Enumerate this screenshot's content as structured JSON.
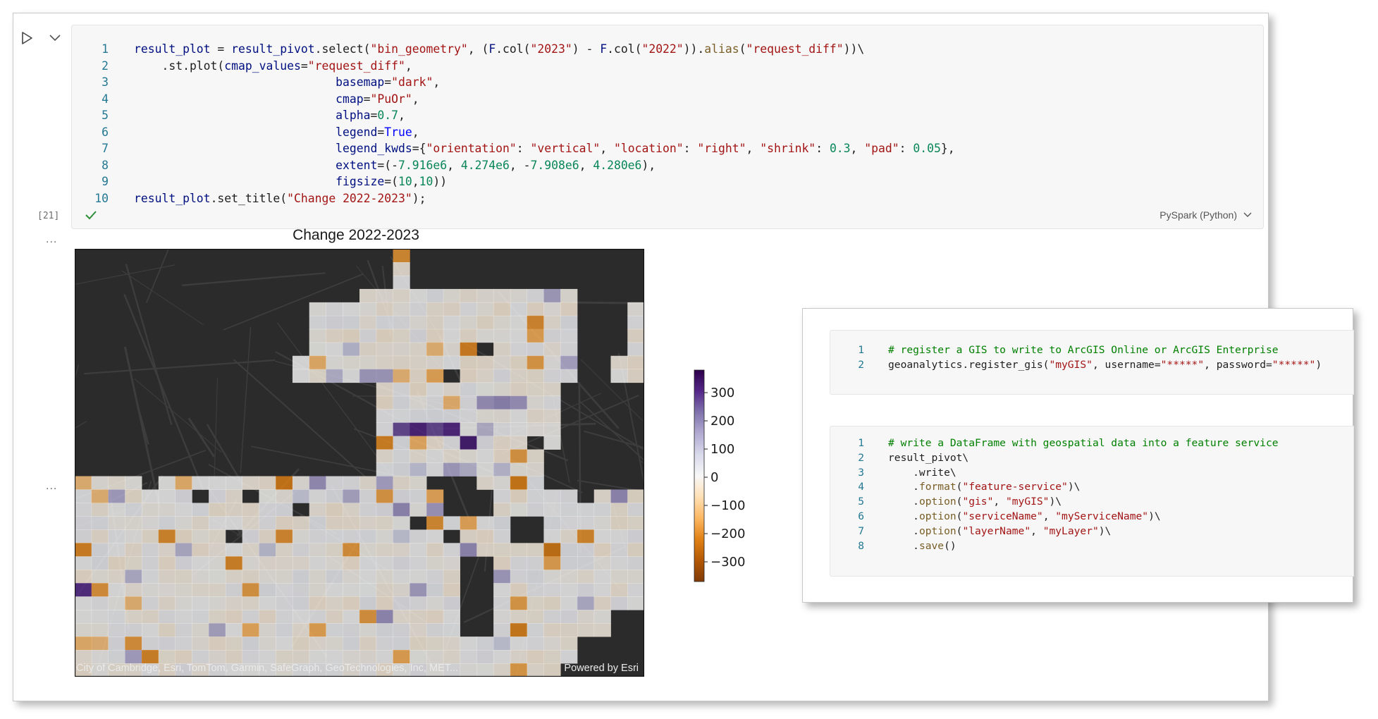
{
  "cell": {
    "execution_count": "[21]",
    "kernel": "PySpark (Python)",
    "lines": [
      {
        "n": "1",
        "t": [
          [
            "v",
            "result_plot"
          ],
          [
            "",
            " = "
          ],
          [
            "v",
            "result_pivot"
          ],
          [
            "",
            ".select("
          ],
          [
            "s",
            "\"bin_geometry\""
          ],
          [
            "",
            ", ("
          ],
          [
            "v",
            "F"
          ],
          [
            "",
            ".col("
          ],
          [
            "s",
            "\"2023\""
          ],
          [
            "",
            ") - "
          ],
          [
            "v",
            "F"
          ],
          [
            "",
            ".col("
          ],
          [
            "s",
            "\"2022\""
          ],
          [
            "",
            "))."
          ],
          [
            "f",
            "alias"
          ],
          [
            "",
            "("
          ],
          [
            "s",
            "\"request_diff\""
          ],
          [
            "",
            "))\\"
          ]
        ]
      },
      {
        "n": "2",
        "t": [
          [
            "",
            "    .st.plot("
          ],
          [
            "v",
            "cmap_values"
          ],
          [
            "",
            "="
          ],
          [
            "s",
            "\"request_diff\""
          ],
          [
            "",
            ","
          ]
        ]
      },
      {
        "n": "3",
        "t": [
          [
            "",
            "                             "
          ],
          [
            "v",
            "basemap"
          ],
          [
            "",
            "="
          ],
          [
            "s",
            "\"dark\""
          ],
          [
            "",
            ","
          ]
        ]
      },
      {
        "n": "4",
        "t": [
          [
            "",
            "                             "
          ],
          [
            "v",
            "cmap"
          ],
          [
            "",
            "="
          ],
          [
            "s",
            "\"PuOr\""
          ],
          [
            "",
            ","
          ]
        ]
      },
      {
        "n": "5",
        "t": [
          [
            "",
            "                             "
          ],
          [
            "v",
            "alpha"
          ],
          [
            "",
            "="
          ],
          [
            "n",
            "0.7"
          ],
          [
            "",
            ","
          ]
        ]
      },
      {
        "n": "6",
        "t": [
          [
            "",
            "                             "
          ],
          [
            "v",
            "legend"
          ],
          [
            "",
            "="
          ],
          [
            "k",
            "True"
          ],
          [
            "",
            ","
          ]
        ]
      },
      {
        "n": "7",
        "t": [
          [
            "",
            "                             "
          ],
          [
            "v",
            "legend_kwds"
          ],
          [
            "",
            "={"
          ],
          [
            "s",
            "\"orientation\""
          ],
          [
            "",
            ": "
          ],
          [
            "s",
            "\"vertical\""
          ],
          [
            "",
            ", "
          ],
          [
            "s",
            "\"location\""
          ],
          [
            "",
            ": "
          ],
          [
            "s",
            "\"right\""
          ],
          [
            "",
            ", "
          ],
          [
            "s",
            "\"shrink\""
          ],
          [
            "",
            ": "
          ],
          [
            "n",
            "0.3"
          ],
          [
            "",
            ", "
          ],
          [
            "s",
            "\"pad\""
          ],
          [
            "",
            ": "
          ],
          [
            "n",
            "0.05"
          ],
          [
            "",
            "},"
          ]
        ]
      },
      {
        "n": "8",
        "t": [
          [
            "",
            "                             "
          ],
          [
            "v",
            "extent"
          ],
          [
            "",
            "=(-"
          ],
          [
            "n",
            "7.916e6"
          ],
          [
            "",
            ", "
          ],
          [
            "n",
            "4.274e6"
          ],
          [
            "",
            ", -"
          ],
          [
            "n",
            "7.908e6"
          ],
          [
            "",
            ", "
          ],
          [
            "n",
            "4.280e6"
          ],
          [
            "",
            "),"
          ]
        ]
      },
      {
        "n": "9",
        "t": [
          [
            "",
            "                             "
          ],
          [
            "v",
            "figsize"
          ],
          [
            "",
            "=("
          ],
          [
            "n",
            "10"
          ],
          [
            "",
            ","
          ],
          [
            "n",
            "10"
          ],
          [
            "",
            "))"
          ]
        ]
      },
      {
        "n": "10",
        "t": [
          [
            "v",
            "result_plot"
          ],
          [
            "",
            ".set_title("
          ],
          [
            "s",
            "\"Change 2022-2023\""
          ],
          [
            "",
            ");"
          ]
        ]
      }
    ]
  },
  "output": {
    "ellipsis": "...",
    "plot_title": "Change 2022-2023",
    "attribution": "City of Cambridge, Esri, TomTom, Garmin, SafeGraph, GeoTechnologies, Inc, MET...",
    "powered_by": "Powered by Esri",
    "colorbar": {
      "cmap": "PuOr",
      "min": -370,
      "max": 380,
      "ticks": [
        "300",
        "200",
        "100",
        "0",
        "−100",
        "−200",
        "−300"
      ],
      "tick_values": [
        300,
        200,
        100,
        0,
        -100,
        -200,
        -300
      ]
    },
    "colors": {
      "dark_base": "#2b2b2b",
      "land_base": "#cfcfd2",
      "purple": "#4b2b85",
      "orange": "#b35806"
    }
  },
  "overlay": {
    "cell1": [
      {
        "n": "1",
        "t": [
          [
            "c",
            "# register a GIS to write to ArcGIS Online or ArcGIS Enterprise"
          ]
        ]
      },
      {
        "n": "2",
        "t": [
          [
            "",
            "geoanalytics.register_gis("
          ],
          [
            "s",
            "\"myGIS\""
          ],
          [
            "",
            ", username="
          ],
          [
            "s",
            "\"*****\""
          ],
          [
            "",
            ", password="
          ],
          [
            "s",
            "\"*****\""
          ],
          [
            "",
            ")"
          ]
        ]
      }
    ],
    "cell2": [
      {
        "n": "1",
        "t": [
          [
            "c",
            "# write a DataFrame with geospatial data into a feature service"
          ]
        ]
      },
      {
        "n": "2",
        "t": [
          [
            "",
            "result_pivot\\"
          ]
        ]
      },
      {
        "n": "3",
        "t": [
          [
            "",
            "    .write\\"
          ]
        ]
      },
      {
        "n": "4",
        "t": [
          [
            "",
            "    ."
          ],
          [
            "f",
            "format"
          ],
          [
            "",
            "("
          ],
          [
            "s",
            "\"feature-service\""
          ],
          [
            "",
            ")\\"
          ]
        ]
      },
      {
        "n": "5",
        "t": [
          [
            "",
            "    ."
          ],
          [
            "f",
            "option"
          ],
          [
            "",
            "("
          ],
          [
            "s",
            "\"gis\""
          ],
          [
            "",
            ", "
          ],
          [
            "s",
            "\"myGIS\""
          ],
          [
            "",
            ")\\"
          ]
        ]
      },
      {
        "n": "6",
        "t": [
          [
            "",
            "    ."
          ],
          [
            "f",
            "option"
          ],
          [
            "",
            "("
          ],
          [
            "s",
            "\"serviceName\""
          ],
          [
            "",
            ", "
          ],
          [
            "s",
            "\"myServiceName\""
          ],
          [
            "",
            ")\\"
          ]
        ]
      },
      {
        "n": "7",
        "t": [
          [
            "",
            "    ."
          ],
          [
            "f",
            "option"
          ],
          [
            "",
            "("
          ],
          [
            "s",
            "\"layerName\""
          ],
          [
            "",
            ", "
          ],
          [
            "s",
            "\"myLayer\""
          ],
          [
            "",
            ")\\"
          ]
        ]
      },
      {
        "n": "8",
        "t": [
          [
            "",
            "    ."
          ],
          [
            "f",
            "save"
          ],
          [
            "",
            "()"
          ]
        ]
      }
    ]
  }
}
